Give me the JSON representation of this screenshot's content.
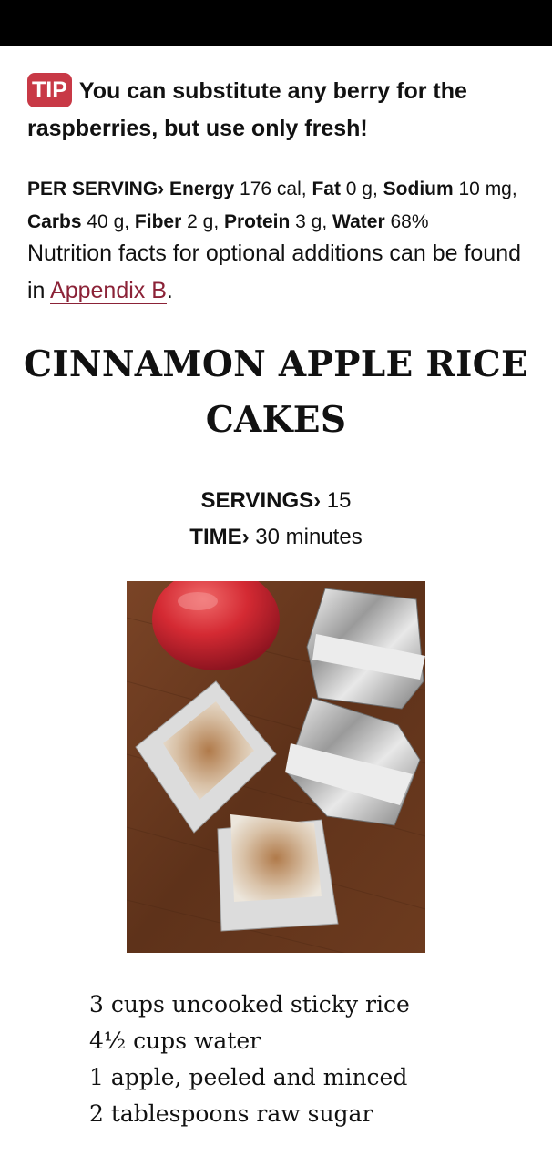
{
  "tip": {
    "badge": "TIP",
    "text": "You can substitute any berry for the raspberries, but use only fresh!"
  },
  "nutrition": {
    "heading": "PER SERVING›",
    "energy_label": "Energy",
    "energy_value": "176 cal",
    "fat_label": "Fat",
    "fat_value": "0 g",
    "sodium_label": "Sodium",
    "sodium_value": "10 mg",
    "carbs_label": "Carbs",
    "carbs_value": "40 g",
    "fiber_label": "Fiber",
    "fiber_value": "2 g",
    "protein_label": "Protein",
    "protein_value": "3 g",
    "water_label": "Water",
    "water_value": "68%"
  },
  "note": {
    "text": "Nutrition facts for optional additions can be found in",
    "link": "Appendix B",
    "end": "."
  },
  "recipe": {
    "title": "CINNAMON APPLE RICE CAKES",
    "servings_label": "SERVINGS›",
    "servings_value": "15",
    "time_label": "TIME›",
    "time_value": "30 minutes"
  },
  "ingredients": [
    "3 cups uncooked sticky rice",
    "4½ cups water",
    "1 apple, peeled and minced",
    "2 tablespoons raw sugar"
  ],
  "colors": {
    "tip_badge": "#c83946",
    "link": "#8b2237",
    "status_bar": "#000000",
    "wood": "#6b3a1f"
  }
}
